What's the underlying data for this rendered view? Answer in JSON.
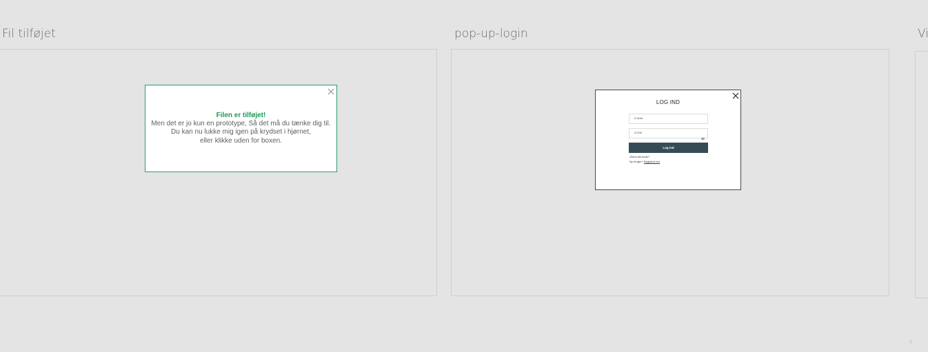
{
  "artboards": [
    {
      "title": "Fil tilføjet"
    },
    {
      "title": "pop-up-login"
    },
    {
      "title": "Vi"
    }
  ],
  "toast": {
    "heading": "Filen er tilføjet!",
    "lines": [
      "Men det er jo kun en prototype, Så det må du tænke dig til.",
      "Du kan nu lukke mig igen på krydset i hjørnet,",
      "eller klikke uden for boxen."
    ],
    "close_icon": "close-icon",
    "accent_color": "#27a06a"
  },
  "login": {
    "title": "LOG IND",
    "email_placeholder": "E-MAIL",
    "password_placeholder": "KODE",
    "button_label": "Log ind",
    "forgot_label": "Glemt din kode?",
    "register_prefix": "Ny bruger?",
    "register_link": "Registrer her",
    "button_color": "#364c55",
    "close_icon": "close-icon",
    "eye_icon": "eye-icon"
  }
}
